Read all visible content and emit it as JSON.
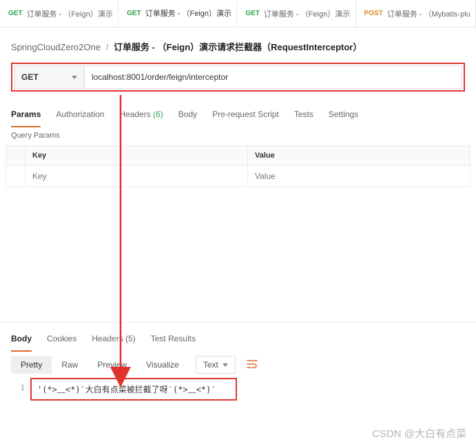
{
  "tabs": [
    {
      "method": "GET",
      "mclass": "m-get",
      "label": "订单服务 - （Feign）演示",
      "active": false
    },
    {
      "method": "GET",
      "mclass": "m-get",
      "label": "订单服务 - （Feign）演示",
      "active": true
    },
    {
      "method": "GET",
      "mclass": "m-get",
      "label": "订单服务 - （Feign）演示",
      "active": false
    },
    {
      "method": "POST",
      "mclass": "m-post",
      "label": "订单服务 - （Mybatis-plu",
      "active": false
    }
  ],
  "breadcrumb": {
    "root": "SpringCloudZero2One",
    "current": "订单服务 - （Feign）演示请求拦截器（RequestInterceptor）"
  },
  "request": {
    "method": "GET",
    "url": "localhost:8001/order/feign/interceptor",
    "tabs": {
      "params": "Params",
      "auth": "Authorization",
      "headers_label": "Headers",
      "headers_count": "(6)",
      "body": "Body",
      "prereq": "Pre-request Script",
      "tests": "Tests",
      "settings": "Settings"
    },
    "query_params_title": "Query Params",
    "table": {
      "key_header": "Key",
      "value_header": "Value",
      "key_placeholder": "Key",
      "value_placeholder": "Value"
    }
  },
  "response": {
    "tabs": {
      "body": "Body",
      "cookies": "Cookies",
      "headers_label": "Headers",
      "headers_count": "(5)",
      "results": "Test Results"
    },
    "view": {
      "pretty": "Pretty",
      "raw": "Raw",
      "preview": "Preview",
      "visualize": "Visualize",
      "type": "Text"
    },
    "line_no": "1",
    "body_text": "'(*>﹏<*)′大白有点菜被拦截了呀′(*>﹏<*)′"
  },
  "watermark": "CSDN @大白有点菜"
}
